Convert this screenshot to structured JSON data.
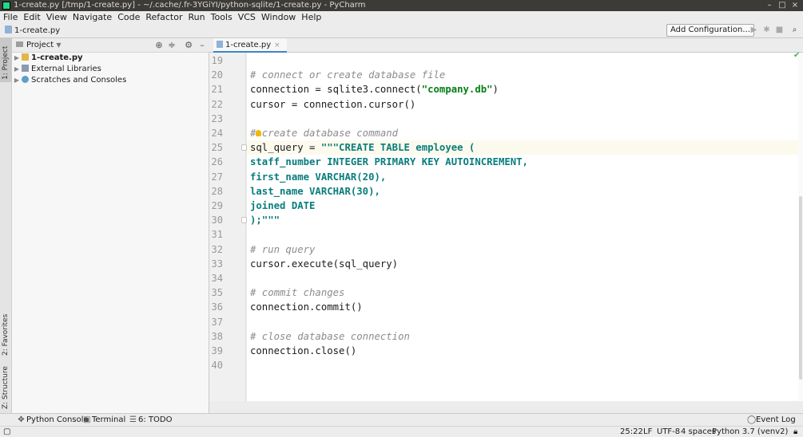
{
  "window": {
    "title": "1-create.py [/tmp/1-create.py] - ~/.cache/.fr-3YGiYI/python-sqlite/1-create.py - PyCharm",
    "controls": {
      "minimize": "–",
      "maximize": "□",
      "close": "×"
    }
  },
  "menu": [
    "File",
    "Edit",
    "View",
    "Navigate",
    "Code",
    "Refactor",
    "Run",
    "Tools",
    "VCS",
    "Window",
    "Help"
  ],
  "navbar": {
    "breadcrumb": "1-create.py",
    "add_configuration": "Add Configuration...",
    "icons": [
      "run-icon",
      "debug-icon",
      "stop-icon",
      "search-icon"
    ]
  },
  "left_stripe": {
    "project": "1: Project",
    "favorites": "2: Favorites",
    "structure": "Z: Structure"
  },
  "project_panel": {
    "title": "Project",
    "items": [
      {
        "label": "1-create.py",
        "icon": "python-file-icon",
        "bold": true
      },
      {
        "label": "External Libraries",
        "icon": "library-icon",
        "bold": false
      },
      {
        "label": "Scratches and Consoles",
        "icon": "scratches-icon",
        "bold": false
      }
    ]
  },
  "editor": {
    "tab_label": "1-create.py",
    "current_line": 25,
    "lines": [
      {
        "n": "19",
        "parts": []
      },
      {
        "n": "20",
        "parts": [
          {
            "t": "# connect or create database file",
            "c": "c-comment"
          }
        ]
      },
      {
        "n": "21",
        "parts": [
          {
            "t": "connection = sqlite3.connect(",
            "c": ""
          },
          {
            "t": "\"company.db\"",
            "c": "c-str"
          },
          {
            "t": ")",
            "c": ""
          }
        ]
      },
      {
        "n": "22",
        "parts": [
          {
            "t": "cursor = connection.cursor()",
            "c": ""
          }
        ]
      },
      {
        "n": "23",
        "parts": []
      },
      {
        "n": "24",
        "parts": [
          {
            "t": "# create database command",
            "c": "c-comment"
          }
        ]
      },
      {
        "n": "25",
        "parts": [
          {
            "t": "sql_query = ",
            "c": ""
          },
          {
            "t": "\"\"\"CREATE TABLE employee (",
            "c": "c-sql"
          }
        ]
      },
      {
        "n": "26",
        "parts": [
          {
            "t": "staff_number INTEGER PRIMARY KEY AUTOINCREMENT,",
            "c": "c-sql"
          }
        ]
      },
      {
        "n": "27",
        "parts": [
          {
            "t": "first_name VARCHAR(20),",
            "c": "c-sql"
          }
        ]
      },
      {
        "n": "28",
        "parts": [
          {
            "t": "last_name VARCHAR(30),",
            "c": "c-sql"
          }
        ]
      },
      {
        "n": "29",
        "parts": [
          {
            "t": "joined DATE",
            "c": "c-sql"
          }
        ]
      },
      {
        "n": "30",
        "parts": [
          {
            "t": ");\"\"\"",
            "c": "c-sql"
          }
        ]
      },
      {
        "n": "31",
        "parts": []
      },
      {
        "n": "32",
        "parts": [
          {
            "t": "# run query",
            "c": "c-comment"
          }
        ]
      },
      {
        "n": "33",
        "parts": [
          {
            "t": "cursor.execute(sql_query)",
            "c": ""
          }
        ]
      },
      {
        "n": "34",
        "parts": []
      },
      {
        "n": "35",
        "parts": [
          {
            "t": "# commit changes",
            "c": "c-comment"
          }
        ]
      },
      {
        "n": "36",
        "parts": [
          {
            "t": "connection.commit()",
            "c": ""
          }
        ]
      },
      {
        "n": "37",
        "parts": []
      },
      {
        "n": "38",
        "parts": [
          {
            "t": "# close database connection",
            "c": "c-comment"
          }
        ]
      },
      {
        "n": "39",
        "parts": [
          {
            "t": "connection.close()",
            "c": ""
          }
        ]
      },
      {
        "n": "40",
        "parts": []
      }
    ]
  },
  "bottom_tools": {
    "python_console": "Python Console",
    "terminal": "Terminal",
    "todo": "6: TODO",
    "event_log": "Event Log"
  },
  "status": {
    "position": "25:22",
    "line_sep": "LF",
    "encoding": "UTF-8",
    "indent": "4 spaces",
    "interpreter": "Python 3.7 (venv2)"
  },
  "colors": {
    "accent": "#4083c9",
    "comment": "#8c8c8c",
    "string": "#067d17",
    "sql": "#0a7d7d",
    "current_line": "#fcfaed"
  }
}
